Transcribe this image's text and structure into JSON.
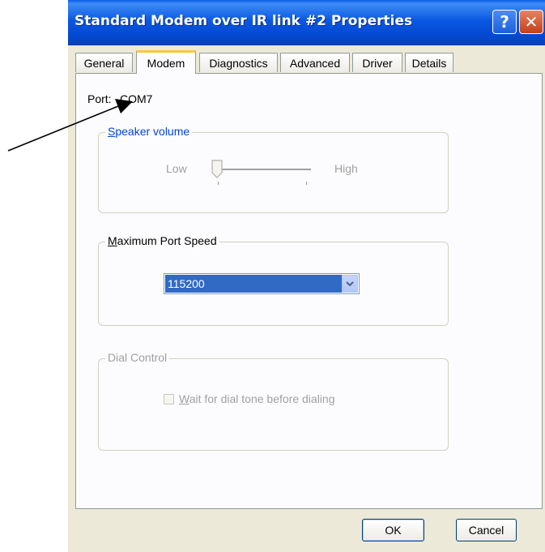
{
  "window": {
    "title": "Standard Modem over IR link #2 Properties",
    "help_glyph": "?",
    "close_glyph": "✕"
  },
  "tabs": [
    {
      "label": "General",
      "active": false
    },
    {
      "label": "Modem",
      "active": true
    },
    {
      "label": "Diagnostics",
      "active": false
    },
    {
      "label": "Advanced",
      "active": false
    },
    {
      "label": "Driver",
      "active": false
    },
    {
      "label": "Details",
      "active": false
    }
  ],
  "port": {
    "label": "Port:",
    "value": "COM7"
  },
  "speaker_volume": {
    "title": "Speaker volume",
    "low_label": "Low",
    "high_label": "High",
    "level": 0,
    "enabled": false
  },
  "max_port_speed": {
    "title": "Maximum Port Speed",
    "selected": "115200"
  },
  "dial_control": {
    "title": "Dial Control",
    "checkbox_label": "Wait for dial tone before dialing",
    "checked": false,
    "enabled": false
  },
  "buttons": {
    "ok": "OK",
    "cancel": "Cancel"
  },
  "colors": {
    "titlebar": "#0a58e2",
    "selection": "#316ac5",
    "group_title": "#0046d5",
    "disabled_text": "#a0a0a0"
  },
  "icons": {
    "help": "help-icon",
    "close": "close-icon",
    "dropdown": "chevron-down-icon",
    "annotation": "annotation-arrow"
  }
}
